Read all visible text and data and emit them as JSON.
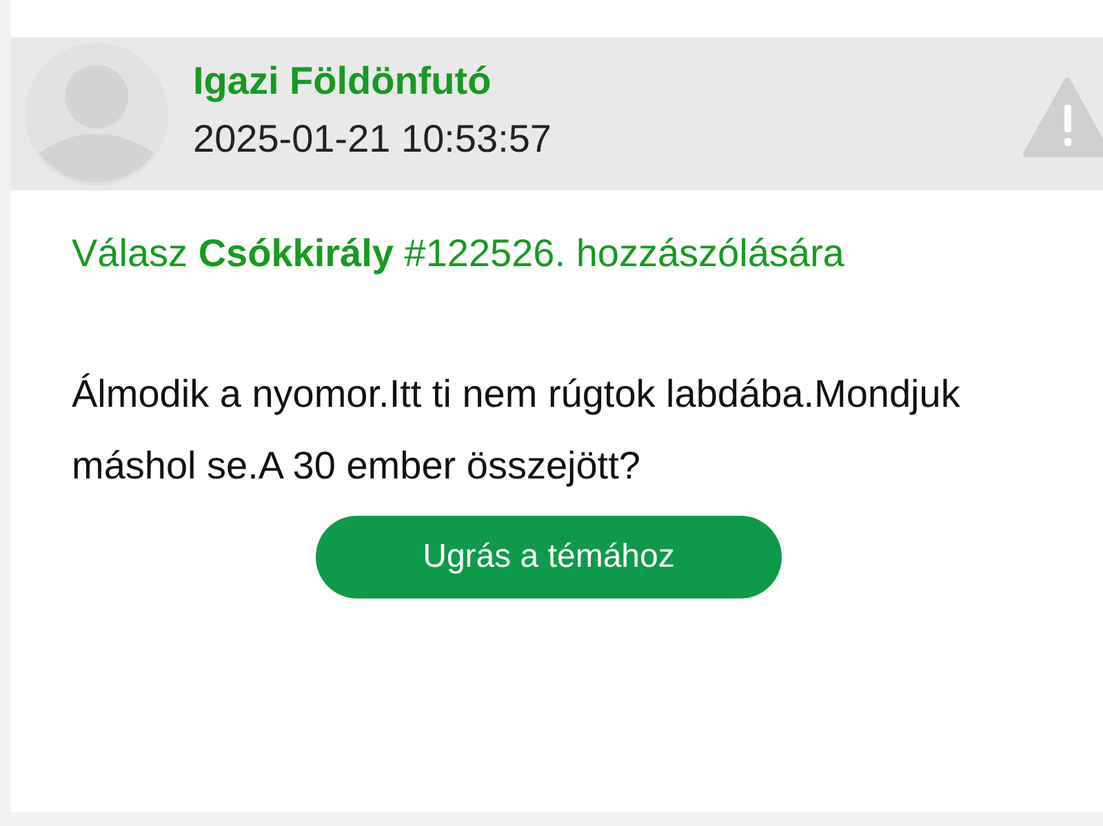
{
  "comment": {
    "author": "Igazi Földönfutó",
    "date": "2025-01-21 10:53:57",
    "reply_to": "Válasz **Csókkirály** #122526. hozzászólására",
    "body": "Álmodik a nyomor.Itt ti nem rúgtok labdába.Mondjuk máshol se.A 30 ember összejött?",
    "button": "Ugrás a témához"
  }
}
